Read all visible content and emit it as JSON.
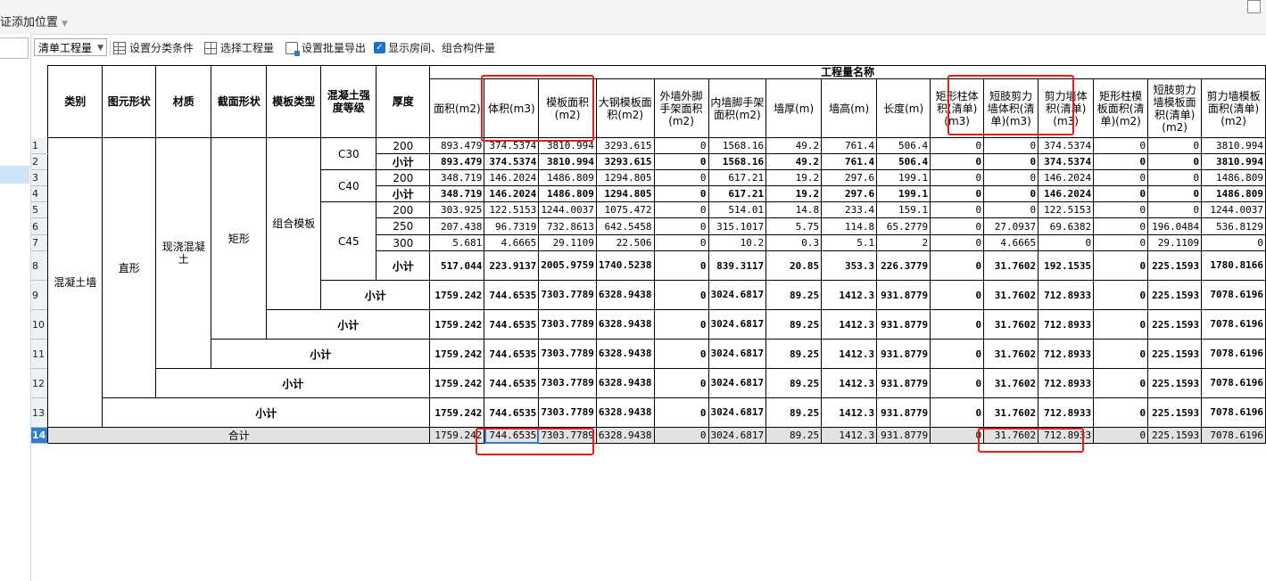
{
  "window": {
    "title": "证添加位置"
  },
  "toolbar": {
    "dropdown_value": "清单工程量",
    "set_category": "设置分类条件",
    "select_qty": "选择工程量",
    "batch_export": "设置批量导出",
    "show_rooms_label": "显示房间、组合构件量",
    "show_rooms_checked": true
  },
  "headers": {
    "category": "类别",
    "shape": "图元形状",
    "material": "材质",
    "section": "截面形状",
    "formwork_type": "模板类型",
    "concrete_grade": "混凝土强度等级",
    "thickness": "厚度",
    "qty_group": "工程量名称",
    "columns": [
      "面积(m2)",
      "体积(m3)",
      "模板面积(m2)",
      "大钢模板面积(m2)",
      "外墙外脚手架面积(m2)",
      "内墙脚手架面积(m2)",
      "墙厚(m)",
      "墙高(m)",
      "长度(m)",
      "矩形柱体积(清单)(m3)",
      "短肢剪力墙体积(清单)(m3)",
      "剪力墙体积(清单)(m3)",
      "矩形柱模板面积(清单)(m2)",
      "短肢剪力墙模板面积(清单)(m2)",
      "剪力墙模板面积(清单)(m2)"
    ]
  },
  "groups": {
    "category": "混凝土墙",
    "shape": "直形",
    "material": "现浇混凝土",
    "section": "矩形",
    "formwork_type": "组合模板",
    "subtotal": "小计",
    "total": "合计"
  },
  "grades": [
    "C30",
    "C40",
    "C45"
  ],
  "rows": [
    {
      "num": "1",
      "thickness": "200",
      "values": [
        "893.479",
        "374.5374",
        "3810.994",
        "3293.615",
        "0",
        "1568.16",
        "49.2",
        "761.4",
        "506.4",
        "0",
        "0",
        "374.5374",
        "0",
        "0",
        "3810.994"
      ]
    },
    {
      "num": "2",
      "thickness": "小计",
      "values": [
        "893.479",
        "374.5374",
        "3810.994",
        "3293.615",
        "0",
        "1568.16",
        "49.2",
        "761.4",
        "506.4",
        "0",
        "0",
        "374.5374",
        "0",
        "0",
        "3810.994"
      ]
    },
    {
      "num": "3",
      "thickness": "200",
      "values": [
        "348.719",
        "146.2024",
        "1486.809",
        "1294.805",
        "0",
        "617.21",
        "19.2",
        "297.6",
        "199.1",
        "0",
        "0",
        "146.2024",
        "0",
        "0",
        "1486.809"
      ]
    },
    {
      "num": "4",
      "thickness": "小计",
      "values": [
        "348.719",
        "146.2024",
        "1486.809",
        "1294.805",
        "0",
        "617.21",
        "19.2",
        "297.6",
        "199.1",
        "0",
        "0",
        "146.2024",
        "0",
        "0",
        "1486.809"
      ]
    },
    {
      "num": "5",
      "thickness": "200",
      "values": [
        "303.925",
        "122.5153",
        "1244.0037",
        "1075.472",
        "0",
        "514.01",
        "14.8",
        "233.4",
        "159.1",
        "0",
        "0",
        "122.5153",
        "0",
        "0",
        "1244.0037"
      ]
    },
    {
      "num": "6",
      "thickness": "250",
      "values": [
        "207.438",
        "96.7319",
        "732.8613",
        "642.5458",
        "0",
        "315.1017",
        "5.75",
        "114.8",
        "65.2779",
        "0",
        "27.0937",
        "69.6382",
        "0",
        "196.0484",
        "536.8129"
      ]
    },
    {
      "num": "7",
      "thickness": "300",
      "values": [
        "5.681",
        "4.6665",
        "29.1109",
        "22.506",
        "0",
        "10.2",
        "0.3",
        "5.1",
        "2",
        "0",
        "4.6665",
        "0",
        "0",
        "29.1109",
        "0"
      ]
    },
    {
      "num": "8",
      "thickness": "小计",
      "values": [
        "517.044",
        "223.9137",
        "2005.9759",
        "1740.5238",
        "0",
        "839.3117",
        "20.85",
        "353.3",
        "226.3779",
        "0",
        "31.7602",
        "192.1535",
        "0",
        "225.1593",
        "1780.8166"
      ]
    },
    {
      "num": "9",
      "values": [
        "1759.242",
        "744.6535",
        "7303.7789",
        "6328.9438",
        "0",
        "3024.6817",
        "89.25",
        "1412.3",
        "931.8779",
        "0",
        "31.7602",
        "712.8933",
        "0",
        "225.1593",
        "7078.6196"
      ]
    },
    {
      "num": "10",
      "values": [
        "1759.242",
        "744.6535",
        "7303.7789",
        "6328.9438",
        "0",
        "3024.6817",
        "89.25",
        "1412.3",
        "931.8779",
        "0",
        "31.7602",
        "712.8933",
        "0",
        "225.1593",
        "7078.6196"
      ]
    },
    {
      "num": "11",
      "values": [
        "1759.242",
        "744.6535",
        "7303.7789",
        "6328.9438",
        "0",
        "3024.6817",
        "89.25",
        "1412.3",
        "931.8779",
        "0",
        "31.7602",
        "712.8933",
        "0",
        "225.1593",
        "7078.6196"
      ]
    },
    {
      "num": "12",
      "values": [
        "1759.242",
        "744.6535",
        "7303.7789",
        "6328.9438",
        "0",
        "3024.6817",
        "89.25",
        "1412.3",
        "931.8779",
        "0",
        "31.7602",
        "712.8933",
        "0",
        "225.1593",
        "7078.6196"
      ]
    },
    {
      "num": "13",
      "values": [
        "1759.242",
        "744.6535",
        "7303.7789",
        "6328.9438",
        "0",
        "3024.6817",
        "89.25",
        "1412.3",
        "931.8779",
        "0",
        "31.7602",
        "712.8933",
        "0",
        "225.1593",
        "7078.6196"
      ]
    },
    {
      "num": "14",
      "values": [
        "1759.242",
        "744.6535",
        "7303.7789",
        "6328.9438",
        "0",
        "3024.6817",
        "89.25",
        "1412.3",
        "931.8779",
        "0",
        "31.7602",
        "712.8933",
        "0",
        "225.1593",
        "7078.6196"
      ]
    }
  ],
  "colors": {
    "highlight_red": "#e0201b",
    "selection_blue": "#2d7fd0"
  }
}
